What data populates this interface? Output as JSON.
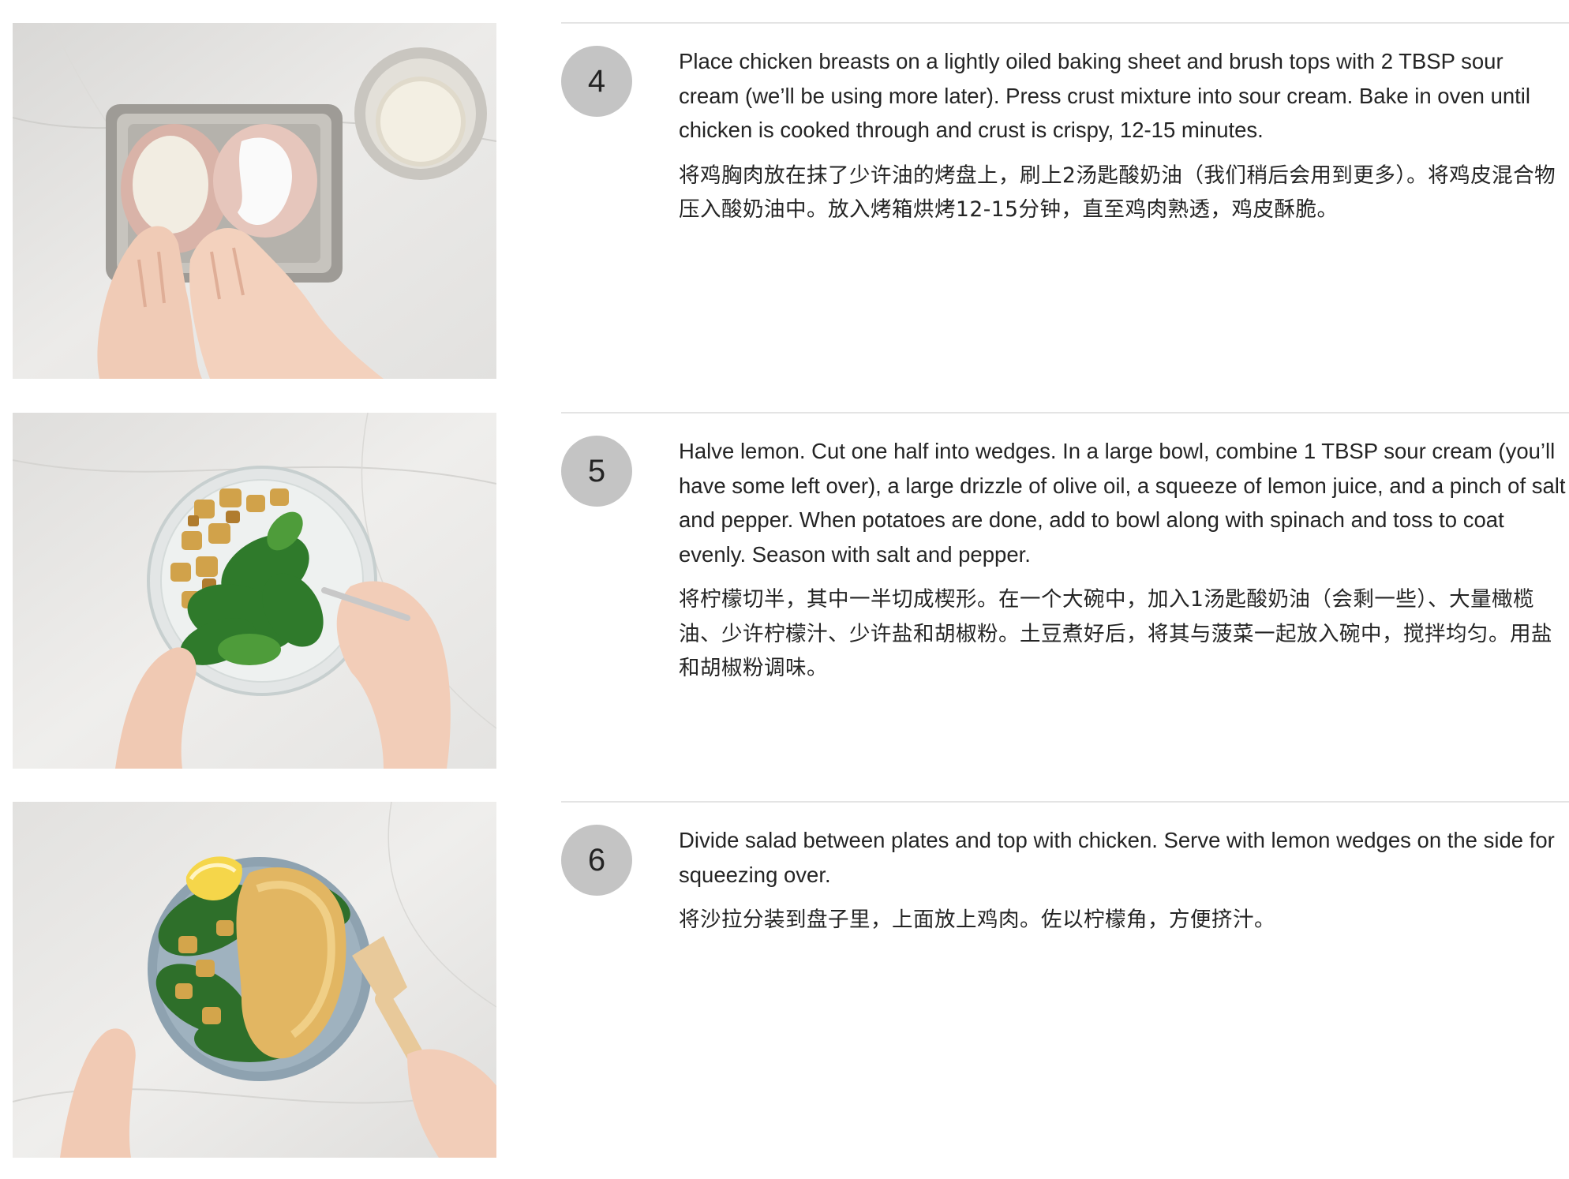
{
  "steps": [
    {
      "number": "4",
      "image_icon": "photo-sour-cream-crust-chicken",
      "text_en": "Place chicken breasts on a lightly oiled baking sheet and brush tops with 2 TBSP sour cream (we’ll be using more later). Press crust mixture into sour cream. Bake in oven until chicken is cooked through and crust is crispy, 12-15 minutes.",
      "text_zh": "将鸡胸肉放在抹了少许油的烤盘上，刷上2汤匙酸奶油（我们稍后会用到更多）。将鸡皮混合物压入酸奶油中。放入烤箱烘烤12-15分钟，直至鸡肉熟透，鸡皮酥脆。"
    },
    {
      "number": "5",
      "image_icon": "photo-potato-spinach-salad-bowl",
      "text_en": "Halve lemon. Cut one half into wedges. In a large bowl, combine 1 TBSP sour cream (you’ll have some left over), a large drizzle of olive oil, a squeeze of lemon juice, and a pinch of salt and pepper. When potatoes are done, add to bowl along with spinach and toss to coat evenly. Season with salt and pepper.",
      "text_zh": "将柠檬切半，其中一半切成楔形。在一个大碗中，加入1汤匙酸奶油（会剩一些）、大量橄榄油、少许柠檬汁、少许盐和胡椒粉。土豆煮好后，将其与菠菜一起放入碗中，搅拌均匀。用盐和胡椒粉调味。"
    },
    {
      "number": "6",
      "image_icon": "photo-plated-chicken-salad",
      "text_en": "Divide salad between plates and top with chicken. Serve with lemon wedges on the side for squeezing over.",
      "text_zh": "将沙拉分装到盘子里，上面放上鸡肉。佐以柠檬角，方便挤汁。"
    }
  ],
  "colors": {
    "step_circle": "#c4c4c4",
    "divider": "#e4e4e4",
    "text": "#242424",
    "marble": "#e9e7e3"
  }
}
